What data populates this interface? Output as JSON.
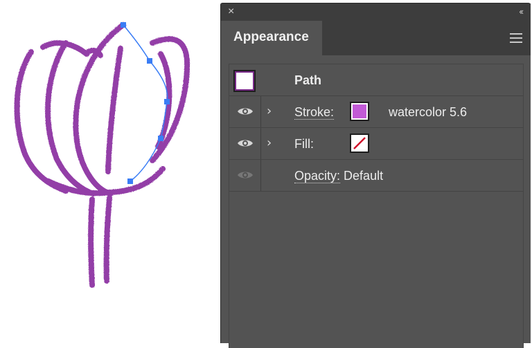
{
  "panel": {
    "close_glyph": "×",
    "collapse_glyph": "‹‹",
    "tab_label": "Appearance",
    "menu_icon": "hamburger-icon"
  },
  "rows": {
    "path": {
      "label": "Path",
      "thumb_color": "#ffffff",
      "thumb_border": "#7a2a8a"
    },
    "stroke": {
      "label": "Stroke:",
      "swatch_color": "#c25ad6",
      "value": "watercolor 5.6",
      "visible": true
    },
    "fill": {
      "label": "Fill:",
      "swatch": "none",
      "visible": true
    },
    "opacity": {
      "label": "Opacity:",
      "value": "Default",
      "visible": true
    }
  },
  "colors": {
    "panel_bg": "#535353",
    "titlebar_bg": "#3d3d3d",
    "stroke_purple": "#8a2fa0",
    "selection_blue": "#3a7df5"
  }
}
